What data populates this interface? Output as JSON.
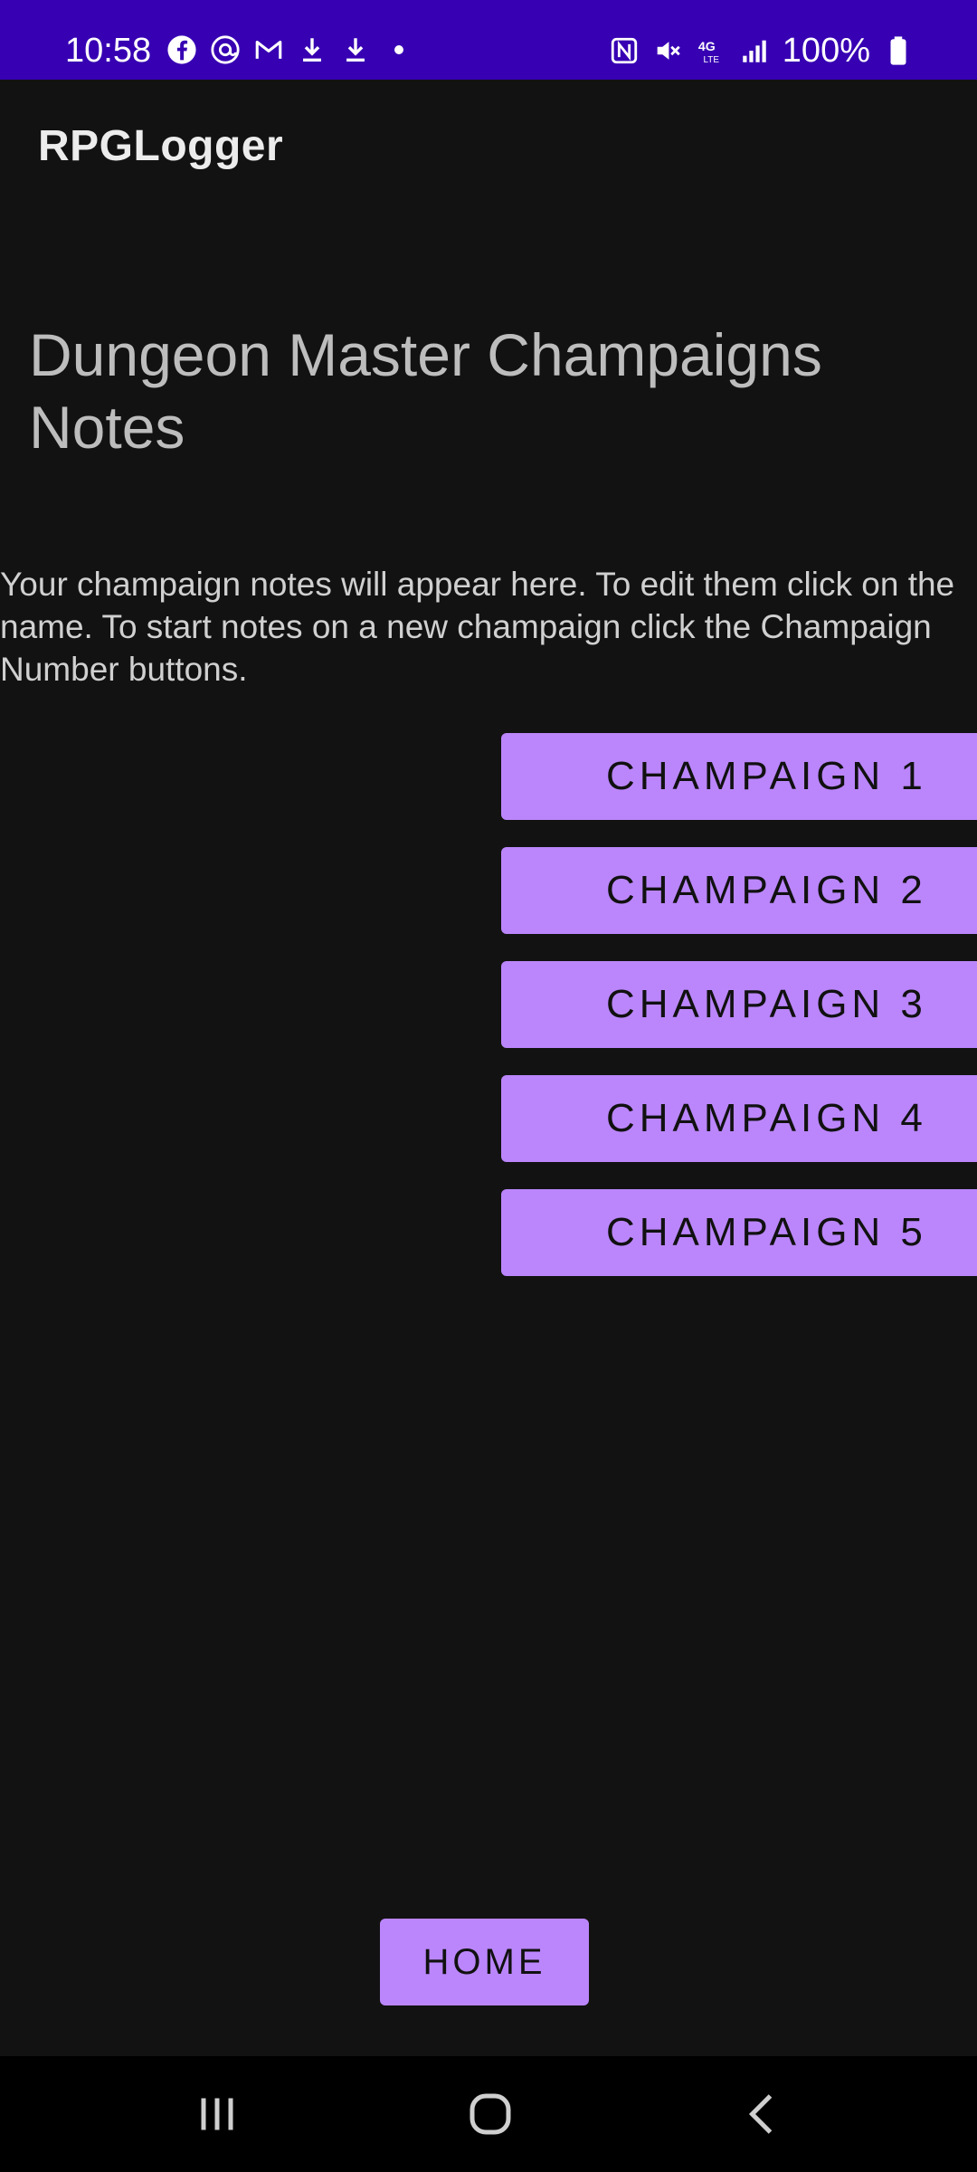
{
  "status_bar": {
    "time": "10:58",
    "left_icons": [
      "facebook-icon",
      "threads-icon",
      "gmail-icon",
      "download-icon",
      "download-icon",
      "dot-icon"
    ],
    "right_icons": [
      "nfc-icon",
      "mute-icon",
      "4g-lte-icon",
      "signal-icon"
    ],
    "battery": "100%",
    "color": "#3700B3"
  },
  "app_bar": {
    "title": "RPGLogger"
  },
  "main": {
    "heading": "Dungeon Master Champaigns Notes",
    "intro": "Your champaign notes will appear here. To edit them click on the name. To start notes on a new champaign click the Champaign Number buttons.",
    "campaign_buttons": [
      "CHAMPAIGN 1",
      "CHAMPAIGN 2",
      "CHAMPAIGN 3",
      "CHAMPAIGN 4",
      "CHAMPAIGN 5"
    ],
    "home_button": "HOME",
    "accent_color": "#BB86FC"
  },
  "nav_bar": {
    "items": [
      "recents-icon",
      "home-icon",
      "back-icon"
    ]
  }
}
